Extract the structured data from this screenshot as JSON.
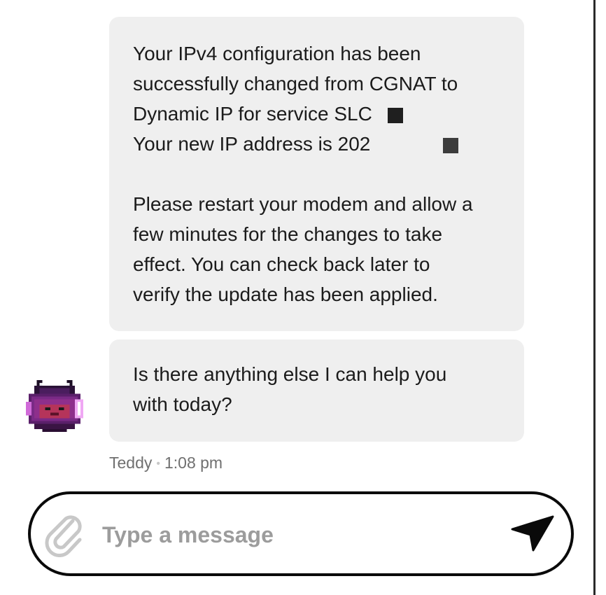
{
  "conversation": {
    "message_1": {
      "lines": [
        "Your IPv4 configuration has been",
        "successfully changed from CGNAT to",
        "Dynamic IP for service SLC",
        "Your new IP address is 202",
        "",
        "Please restart your modem and allow a",
        "few minutes for the changes to take",
        "effect. You can check back later to",
        "verify the update has been applied."
      ]
    },
    "message_2": {
      "lines": [
        "Is there anything else I can help you",
        "with today?"
      ]
    },
    "sender": {
      "name": "Teddy",
      "separator": "•",
      "time": "1:08 pm",
      "avatar_icon": "pixel-purple-cat-avatar"
    }
  },
  "composer": {
    "placeholder": "Type a message",
    "value": "",
    "attach_icon": "paperclip-icon",
    "send_icon": "send-arrow-icon"
  },
  "colors": {
    "bubble_bg": "#efefef",
    "text": "#1b1b1b",
    "placeholder": "#9c9c9c",
    "border": "#0a0a0a",
    "meta": "#707070"
  }
}
